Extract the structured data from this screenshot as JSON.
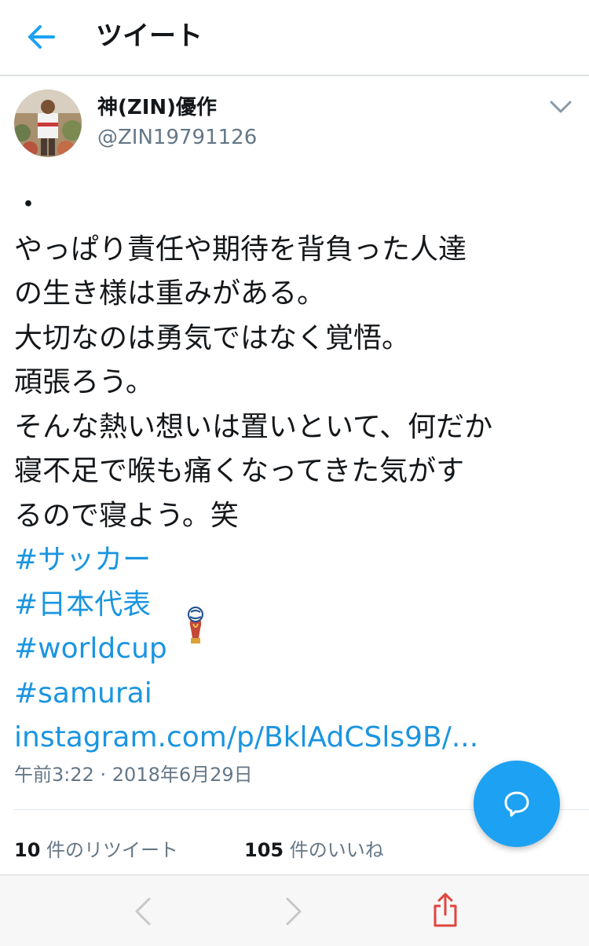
{
  "header": {
    "title": "ツイート"
  },
  "author": {
    "name": "神(ZIN)優作",
    "handle": "@ZIN19791126"
  },
  "tweet": {
    "lines": [
      "・",
      "やっぱり責任や期待を背負った人達",
      "の生き様は重みがある。",
      "大切なのは勇気ではなく覚悟。",
      "頑張ろう。",
      "そんな熱い想いは置いといて、何だか",
      "寝不足で喉も痛くなってきた気がす",
      "るので寝よう。笑"
    ],
    "hashtags": [
      "#サッカー",
      "#日本代表",
      "#worldcup",
      "#samurai"
    ],
    "link": "instagram.com/p/BklAdCSls9B/...",
    "timestamp": "午前3:22 · 2018年6月29日"
  },
  "stats": {
    "retweets_count": "10",
    "retweets_label": " 件のリツイート",
    "likes_count": "105",
    "likes_label": " 件のいいね"
  },
  "icons": {
    "back": "back-arrow-icon",
    "menu": "chevron-down-icon",
    "reply": "reply-bubble-icon",
    "browser_back": "chevron-left-icon",
    "browser_forward": "chevron-right-icon",
    "share": "share-icon",
    "emoji": "world-cup-trophy-emoji"
  },
  "colors": {
    "accent": "#1da1f2",
    "link": "#1b95e0",
    "muted": "#657786",
    "share": "#e0463f"
  }
}
